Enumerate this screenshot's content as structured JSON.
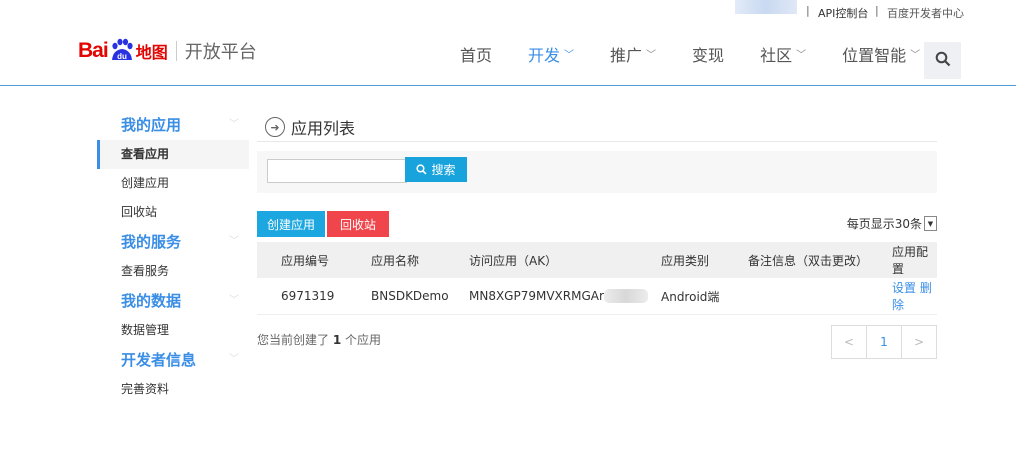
{
  "topbar": {
    "api_console": "API控制台",
    "dev_center": "百度开发者中心"
  },
  "header": {
    "logo_bai": "Bai",
    "logo_du": "du",
    "logo_ditu": "地图",
    "platform_name": "开放平台",
    "nav": [
      {
        "label": "首页",
        "has_chevron": false
      },
      {
        "label": "开发",
        "has_chevron": true,
        "active": true
      },
      {
        "label": "推广",
        "has_chevron": true
      },
      {
        "label": "变现",
        "has_chevron": false
      },
      {
        "label": "社区",
        "has_chevron": true
      },
      {
        "label": "位置智能",
        "has_chevron": true
      }
    ]
  },
  "sidebar": {
    "groups": [
      {
        "label": "我的应用",
        "items": [
          "查看应用",
          "创建应用",
          "回收站"
        ]
      },
      {
        "label": "我的服务",
        "items": [
          "查看服务"
        ]
      },
      {
        "label": "我的数据",
        "items": [
          "数据管理"
        ]
      },
      {
        "label": "开发者信息",
        "items": [
          "完善资料"
        ]
      }
    ]
  },
  "main": {
    "title": "应用列表",
    "search_button": "搜索",
    "search_value": "",
    "create_button": "创建应用",
    "recycle_button": "回收站",
    "per_page": "每页显示30条",
    "table": {
      "headers": [
        "应用编号",
        "应用名称",
        "访问应用（AK）",
        "应用类别",
        "备注信息（双击更改）",
        "应用配置"
      ],
      "rows": [
        {
          "id": "6971319",
          "name": "BNSDKDemo",
          "ak": "MN8XGP79MVXRMGAr",
          "category": "Android端",
          "note": "",
          "cfg_set": "设置",
          "cfg_del": "删除"
        }
      ]
    },
    "count_prefix": "您当前创建了",
    "count_value": "1",
    "count_suffix": "个应用",
    "pager": {
      "prev": "<",
      "current": "1",
      "next": ">"
    }
  },
  "colors": {
    "accent": "#3a8ee6",
    "brand_red": "#e10601",
    "create_btn": "#1ca7e1",
    "recycle_btn": "#f0464b"
  }
}
